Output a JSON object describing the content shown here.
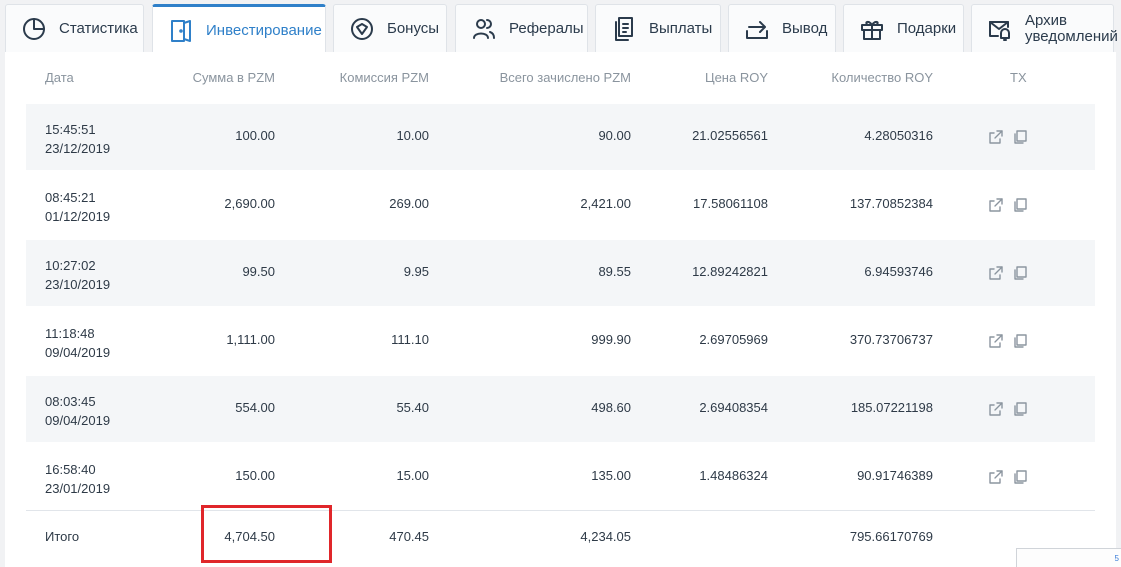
{
  "tabs": [
    {
      "label": "Статистика",
      "icon": "chart-pie-icon"
    },
    {
      "label": "Инвестирование",
      "icon": "door-icon",
      "active": true
    },
    {
      "label": "Бонусы",
      "icon": "bonus-badge-icon"
    },
    {
      "label": "Рефералы",
      "icon": "users-icon"
    },
    {
      "label": "Выплаты",
      "icon": "receipt-icon"
    },
    {
      "label": "Вывод",
      "icon": "withdraw-arrow-icon"
    },
    {
      "label": "Подарки",
      "icon": "gift-icon"
    },
    {
      "label_line1": "Архив",
      "label_line2": "уведомлений",
      "icon": "bell-archive-icon"
    }
  ],
  "table": {
    "headers": {
      "date": "Дата",
      "amount": "Сумма в PZM",
      "commission": "Комиссия PZM",
      "total_credited": "Всего зачислено PZM",
      "price": "Цена ROY",
      "quantity": "Количество ROY",
      "tx": "TX"
    },
    "rows": [
      {
        "time": "15:45:51",
        "date": "23/12/2019",
        "amount": "100.00",
        "commission": "10.00",
        "total": "90.00",
        "price": "21.02556561",
        "qty": "4.28050316"
      },
      {
        "time": "08:45:21",
        "date": "01/12/2019",
        "amount": "2,690.00",
        "commission": "269.00",
        "total": "2,421.00",
        "price": "17.58061108",
        "qty": "137.70852384"
      },
      {
        "time": "10:27:02",
        "date": "23/10/2019",
        "amount": "99.50",
        "commission": "9.95",
        "total": "89.55",
        "price": "12.89242821",
        "qty": "6.94593746"
      },
      {
        "time": "11:18:48",
        "date": "09/04/2019",
        "amount": "1,111.00",
        "commission": "111.10",
        "total": "999.90",
        "price": "2.69705969",
        "qty": "370.73706737"
      },
      {
        "time": "08:03:45",
        "date": "09/04/2019",
        "amount": "554.00",
        "commission": "55.40",
        "total": "498.60",
        "price": "2.69408354",
        "qty": "185.07221198"
      },
      {
        "time": "16:58:40",
        "date": "23/01/2019",
        "amount": "150.00",
        "commission": "15.00",
        "total": "135.00",
        "price": "1.48486324",
        "qty": "90.91746389"
      }
    ],
    "totals": {
      "label": "Итого",
      "amount": "4,704.50",
      "commission": "470.45",
      "total": "4,234.05",
      "qty": "795.66170769"
    }
  },
  "corner_widget_text": "5",
  "colors": {
    "accent": "#2f80c9",
    "highlight": "#e0262a",
    "row_alt": "#f4f6f8"
  }
}
